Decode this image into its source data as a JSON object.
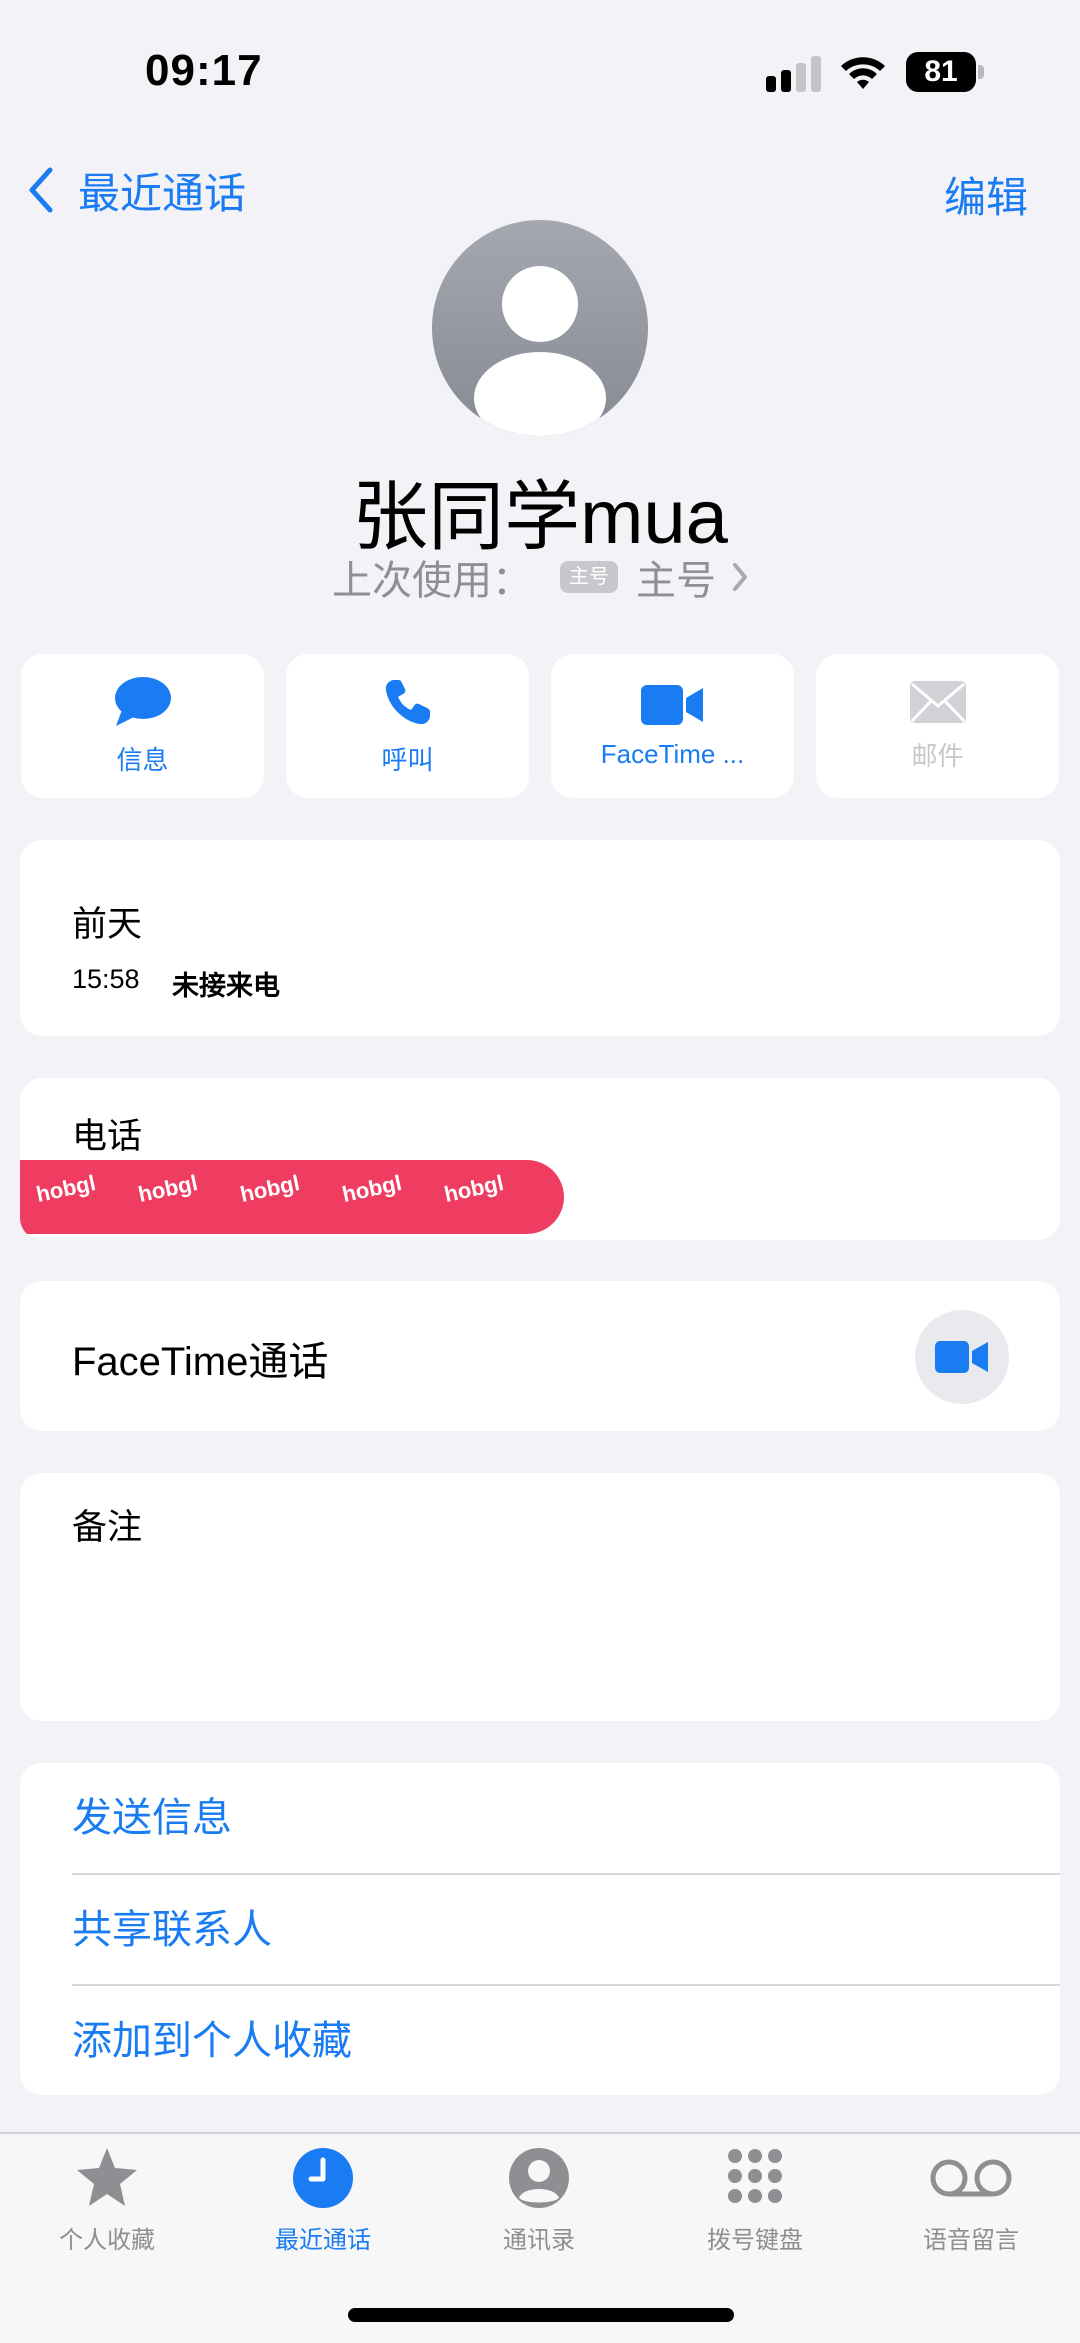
{
  "status_bar": {
    "time": "09:17",
    "battery": "81"
  },
  "nav": {
    "back_label": "最近通话",
    "edit_label": "编辑"
  },
  "contact": {
    "name": "张同学mua",
    "last_used_label": "上次使用：",
    "sim_badge": "主号",
    "line_name": "主号"
  },
  "actions": [
    {
      "label": "信息",
      "icon": "message-bubble-icon",
      "enabled": true
    },
    {
      "label": "呼叫",
      "icon": "phone-icon",
      "enabled": true
    },
    {
      "label": "FaceTime ...",
      "icon": "video-camera-icon",
      "enabled": true
    },
    {
      "label": "邮件",
      "icon": "envelope-icon",
      "enabled": false
    }
  ],
  "recent_call": {
    "day": "前天",
    "time": "15:58",
    "status": "未接来电"
  },
  "phone": {
    "label": "电话",
    "number_redacted": true,
    "redaction_text": "hobgl"
  },
  "facetime": {
    "label": "FaceTime通话"
  },
  "notes": {
    "label": "备注"
  },
  "links": [
    "发送信息",
    "共享联系人",
    "添加到个人收藏"
  ],
  "tabbar": {
    "tabs": [
      {
        "label": "个人收藏",
        "icon": "star-icon",
        "active": false
      },
      {
        "label": "最近通话",
        "icon": "clock-icon",
        "active": true
      },
      {
        "label": "通讯录",
        "icon": "person-circle-icon",
        "active": false
      },
      {
        "label": "拨号键盘",
        "icon": "keypad-icon",
        "active": false
      },
      {
        "label": "语音留言",
        "icon": "voicemail-icon",
        "active": false
      }
    ]
  },
  "colors": {
    "accent": "#1a7cf2",
    "background": "#f2f2f7",
    "card": "#ffffff",
    "secondary_text": "#8e8e93",
    "redaction": "#ef3d61"
  }
}
